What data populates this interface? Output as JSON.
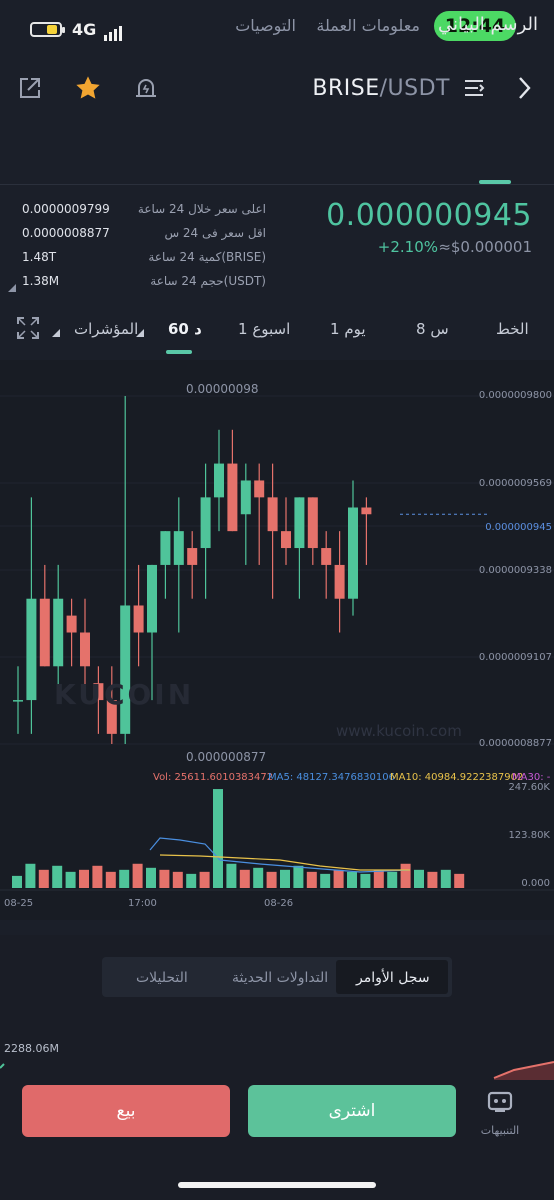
{
  "status": {
    "network": "4G",
    "time": "12:44"
  },
  "header": {
    "pair_base": "BRISE",
    "pair_quote": "/USDT"
  },
  "tabs": [
    {
      "label": "الرسم البياني"
    },
    {
      "label": "معلومات العملة"
    },
    {
      "label": "التوصيات"
    }
  ],
  "ticker": {
    "last_price": "0.000000945",
    "change": "+2.10%",
    "approx": "≈$0.000001",
    "stats": [
      {
        "label": "اعلى سعر خلال 24 ساعة",
        "value": "0.0000009799"
      },
      {
        "label": "اقل سعر فى 24 س",
        "value": "0.0000008877"
      },
      {
        "label": "كمية 24 ساعة(BRISE)",
        "value": "1.48T"
      },
      {
        "label": "حجم 24 ساعة(USDT)",
        "value": "1.38M"
      }
    ]
  },
  "intervals": {
    "line": "الخط",
    "h8": "8 س",
    "d1": "1 يوم",
    "w1": "1 اسبوع",
    "m60": "60 د",
    "indicators": "المؤشرات"
  },
  "chart": {
    "y_ticks": [
      "0.0000009800",
      "0.0000009569",
      "0.000000945",
      "0.0000009338",
      "0.0000009107",
      "0.0000008877"
    ],
    "high_marker": "0.00000098",
    "low_marker": "0.000000877",
    "watermark": "www.kucoin.com",
    "logo_text": "KUCOIN",
    "volume_legend": {
      "vol": "Vol: 25611.6010383472",
      "ma5": "MA5: 48127.3476830106",
      "ma10": "MA10: 40984.9222387902",
      "ma30": "MA30: -"
    },
    "volume_ticks": [
      "247.60K",
      "123.80K",
      "0.000"
    ],
    "x_ticks": [
      "08-25",
      "17:00",
      "08-26"
    ],
    "colors": {
      "up": "#4fc49a",
      "down": "#e5726b",
      "ma5": "#4a8fe0",
      "ma10": "#e8c24a",
      "ma30": "#c85ad6"
    }
  },
  "chart_data": {
    "type": "candlestick",
    "series": [
      {
        "o": 8.9e-07,
        "h": 9e-07,
        "l": 8.8e-07,
        "c": 8.9e-07
      },
      {
        "o": 8.9e-07,
        "h": 9.5e-07,
        "l": 8.8e-07,
        "c": 9.2e-07
      },
      {
        "o": 9.2e-07,
        "h": 9.3e-07,
        "l": 9e-07,
        "c": 9e-07
      },
      {
        "o": 9e-07,
        "h": 9.3e-07,
        "l": 8.9e-07,
        "c": 9.2e-07
      },
      {
        "o": 9.15e-07,
        "h": 9.2e-07,
        "l": 9e-07,
        "c": 9.1e-07
      },
      {
        "o": 9.1e-07,
        "h": 9.2e-07,
        "l": 8.9e-07,
        "c": 9e-07
      },
      {
        "o": 8.95e-07,
        "h": 9e-07,
        "l": 8.8e-07,
        "c": 8.9e-07
      },
      {
        "o": 8.9e-07,
        "h": 9e-07,
        "l": 8.77e-07,
        "c": 8.8e-07
      },
      {
        "o": 8.8e-07,
        "h": 9.8e-07,
        "l": 8.77e-07,
        "c": 9.18e-07
      },
      {
        "o": 9.18e-07,
        "h": 9.3e-07,
        "l": 9e-07,
        "c": 9.1e-07
      },
      {
        "o": 9.1e-07,
        "h": 9.3e-07,
        "l": 8.9e-07,
        "c": 9.3e-07
      },
      {
        "o": 9.3e-07,
        "h": 9.4e-07,
        "l": 9.2e-07,
        "c": 9.4e-07
      },
      {
        "o": 9.3e-07,
        "h": 9.5e-07,
        "l": 9.1e-07,
        "c": 9.4e-07
      },
      {
        "o": 9.35e-07,
        "h": 9.4e-07,
        "l": 9.2e-07,
        "c": 9.3e-07
      },
      {
        "o": 9.35e-07,
        "h": 9.6e-07,
        "l": 9.2e-07,
        "c": 9.5e-07
      },
      {
        "o": 9.5e-07,
        "h": 9.7e-07,
        "l": 9.4e-07,
        "c": 9.6e-07
      },
      {
        "o": 9.6e-07,
        "h": 9.7e-07,
        "l": 9.4e-07,
        "c": 9.4e-07
      },
      {
        "o": 9.45e-07,
        "h": 9.6e-07,
        "l": 9.3e-07,
        "c": 9.55e-07
      },
      {
        "o": 9.55e-07,
        "h": 9.6e-07,
        "l": 9.3e-07,
        "c": 9.5e-07
      },
      {
        "o": 9.5e-07,
        "h": 9.6e-07,
        "l": 9.2e-07,
        "c": 9.4e-07
      },
      {
        "o": 9.4e-07,
        "h": 9.5e-07,
        "l": 9.3e-07,
        "c": 9.35e-07
      },
      {
        "o": 9.35e-07,
        "h": 9.5e-07,
        "l": 9.2e-07,
        "c": 9.5e-07
      },
      {
        "o": 9.5e-07,
        "h": 9.5e-07,
        "l": 9.3e-07,
        "c": 9.35e-07
      },
      {
        "o": 9.35e-07,
        "h": 9.4e-07,
        "l": 9.2e-07,
        "c": 9.3e-07
      },
      {
        "o": 9.3e-07,
        "h": 9.4e-07,
        "l": 9.1e-07,
        "c": 9.2e-07
      },
      {
        "o": 9.2e-07,
        "h": 9.55e-07,
        "l": 9.15e-07,
        "c": 9.47e-07
      },
      {
        "o": 9.47e-07,
        "h": 9.5e-07,
        "l": 9.3e-07,
        "c": 9.45e-07
      }
    ]
  },
  "volume_data": {
    "values": [
      30,
      60,
      45,
      55,
      40,
      45,
      55,
      40,
      45,
      60,
      50,
      45,
      40,
      35,
      40,
      245,
      60,
      45,
      50,
      40,
      45,
      55,
      40,
      35,
      45,
      40,
      35,
      45,
      40,
      60,
      45,
      40,
      45,
      35
    ],
    "up": [
      true,
      true,
      false,
      true,
      true,
      false,
      false,
      false,
      true,
      false,
      true,
      false,
      false,
      true,
      false,
      true,
      true,
      false,
      true,
      false,
      true,
      true,
      false,
      true,
      false,
      true,
      true,
      false,
      true,
      false,
      true,
      false,
      true,
      false
    ]
  },
  "lower_tabs": {
    "order_book": "سجل الأوامر",
    "recent_trades": "التداولات الحديثة",
    "analysis": "التحليلات"
  },
  "depth": {
    "label": "2288.06M"
  },
  "actions": {
    "sell": "بيع",
    "buy": "اشترى",
    "alerts": "التنبيهات"
  }
}
